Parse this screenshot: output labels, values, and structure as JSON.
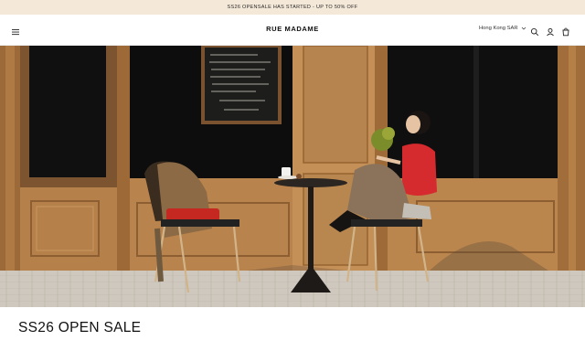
{
  "announcement": {
    "text": "SS26 OPENSALE HAS STARTED - UP TO 50% OFF"
  },
  "header": {
    "menu_icon": "hamburger-menu-icon",
    "logo": "RUE MADAME",
    "region": "Hong Kong SAR",
    "region_icon": "chevron-down-icon",
    "search_icon": "search-icon",
    "account_icon": "account-icon",
    "cart_icon": "cart-icon"
  },
  "hero": {
    "chalkboard_lines": [
      "",
      "",
      "",
      "",
      "",
      "",
      "",
      ""
    ]
  },
  "section": {
    "title": "SS26 OPEN SALE"
  },
  "colors": {
    "announcement_bg": "#f4e8d8",
    "wood": "#b7834f",
    "accent_red": "#d7262b"
  }
}
